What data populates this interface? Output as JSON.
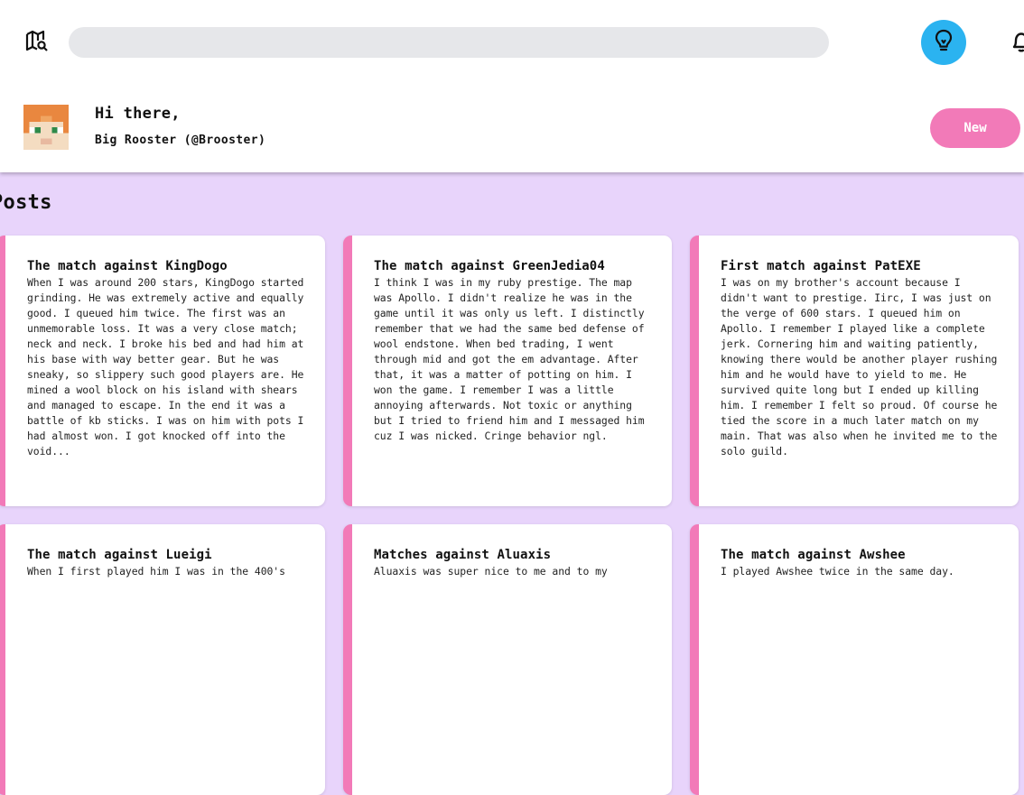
{
  "header": {
    "search_placeholder": "",
    "greeting": "Hi there,",
    "user_name": "Big Rooster (@Brooster)",
    "new_button_label": "New"
  },
  "icons": {
    "map": "map-search-icon",
    "lightbulb": "lightbulb-icon",
    "bell": "bell-icon",
    "avatar": "pixel-avatar"
  },
  "colors": {
    "accent_pink": "#f27ab8",
    "lightbulb_blue": "#2bb3f0",
    "page_background": "#e8d4fb",
    "search_background": "#e6e7ea"
  },
  "section_title": "Posts",
  "posts": [
    {
      "title": "The match against KingDogo",
      "body": "When I was around 200 stars, KingDogo started grinding. He was extremely active and equally good. I queued him twice. The first was an unmemorable loss. It was a very close match; neck and neck. I broke his bed and had him at his base with way better gear. But he was sneaky, so slippery such good players are. He mined a wool block on his island with shears and managed to escape. In the end it was a battle of kb sticks. I was on him with pots I had almost won. I got knocked off into the void..."
    },
    {
      "title": "The match against GreenJedia04",
      "body": "I think I was in my ruby prestige. The map was Apollo. I didn't realize he was in the game until it was only us left. I distinctly remember that we had the same bed defense of wool endstone. When bed trading, I went through mid and got the em advantage. After that, it was a matter of potting on him. I won the game. I remember I was a little annoying afterwards. Not toxic or anything but I tried to friend him and I messaged him cuz I was nicked. Cringe behavior ngl."
    },
    {
      "title": "First match against PatEXE",
      "body": "I was on my brother's account because I didn't want to prestige. Iirc, I was just on the verge of 600 stars. I queued him on Apollo. I remember I played like a complete jerk. Cornering him and waiting patiently, knowing there would be another player rushing him and he would have to yield to me. He survived quite long but I ended up killing him. I remember I felt so proud. Of course he tied the score in a much later match on my main. That was also when he invited me to the solo guild."
    },
    {
      "title": "The match against Lueigi",
      "body": "When I first played him I was in the 400's"
    },
    {
      "title": "Matches against Aluaxis",
      "body": "Aluaxis was super nice to me and to my"
    },
    {
      "title": "The match against Awshee",
      "body": "I played Awshee twice in the same day."
    }
  ]
}
